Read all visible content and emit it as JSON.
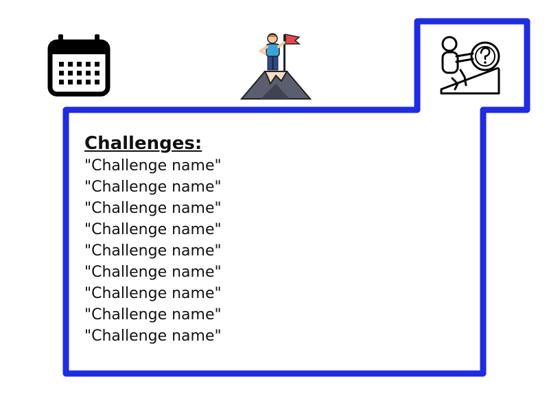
{
  "tabs": [
    {
      "name": "calendar",
      "icon": "calendar-icon"
    },
    {
      "name": "goal",
      "icon": "mountain-summit-flag-icon"
    },
    {
      "name": "challenges",
      "icon": "person-pushing-boulder-uphill-icon",
      "selected": true
    }
  ],
  "panel": {
    "title": "Challenges:",
    "items": [
      "\"Challenge name\"",
      "\"Challenge name\"",
      "\"Challenge name\"",
      "\"Challenge name\"",
      "\"Challenge name\"",
      "\"Challenge name\"",
      "\"Challenge name\"",
      "\"Challenge name\"",
      "\"Challenge name\""
    ]
  },
  "colors": {
    "active_tab_border": "#1f2ce0",
    "text": "#111111",
    "flag": "#e8474a",
    "mountain": "#5a5e6e",
    "snow": "#f6dcc0",
    "shirt": "#3aa3d8"
  }
}
